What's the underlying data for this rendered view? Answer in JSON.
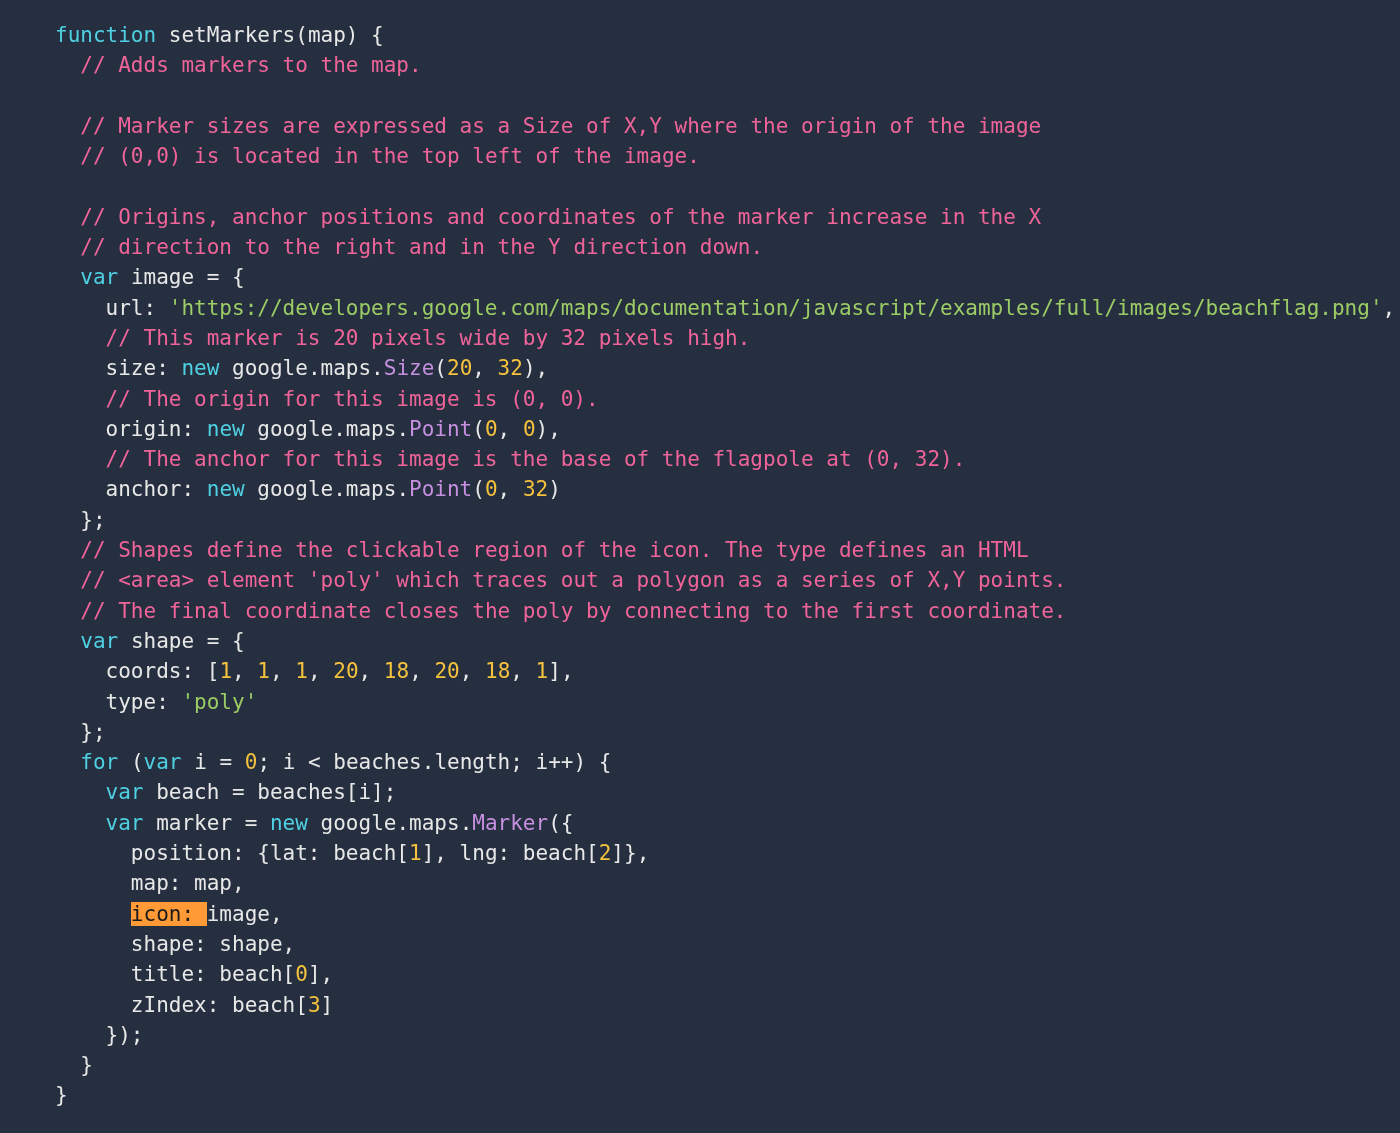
{
  "code_lines": [
    {
      "kind": "code",
      "tokens": [
        {
          "kind": "keyword",
          "text": "function"
        },
        {
          "kind": "plain",
          "text": " setMarkers(map) {"
        }
      ]
    },
    {
      "kind": "code",
      "tokens": [
        {
          "kind": "comment",
          "text": "  // Adds markers to the map."
        }
      ]
    },
    {
      "kind": "blank"
    },
    {
      "kind": "code",
      "tokens": [
        {
          "kind": "comment",
          "text": "  // Marker sizes are expressed as a Size of X,Y where the origin of the image"
        }
      ]
    },
    {
      "kind": "code",
      "tokens": [
        {
          "kind": "comment",
          "text": "  // (0,0) is located in the top left of the image."
        }
      ]
    },
    {
      "kind": "blank"
    },
    {
      "kind": "code",
      "tokens": [
        {
          "kind": "comment",
          "text": "  // Origins, anchor positions and coordinates of the marker increase in the X"
        }
      ]
    },
    {
      "kind": "code",
      "tokens": [
        {
          "kind": "comment",
          "text": "  // direction to the right and in the Y direction down."
        }
      ]
    },
    {
      "kind": "code",
      "tokens": [
        {
          "kind": "keyword",
          "text": "  var"
        },
        {
          "kind": "plain",
          "text": " image = {"
        }
      ]
    },
    {
      "kind": "code",
      "tokens": [
        {
          "kind": "plain",
          "text": "    url: "
        },
        {
          "kind": "string",
          "text": "'https://developers.google.com/maps/documentation/javascript/examples/full/images/beachflag.png'"
        },
        {
          "kind": "plain",
          "text": ","
        }
      ]
    },
    {
      "kind": "code",
      "tokens": [
        {
          "kind": "comment",
          "text": "    // This marker is 20 pixels wide by 32 pixels high."
        }
      ]
    },
    {
      "kind": "code",
      "tokens": [
        {
          "kind": "plain",
          "text": "    size: "
        },
        {
          "kind": "keyword",
          "text": "new"
        },
        {
          "kind": "plain",
          "text": " google.maps."
        },
        {
          "kind": "method",
          "text": "Size"
        },
        {
          "kind": "plain",
          "text": "("
        },
        {
          "kind": "number",
          "text": "20"
        },
        {
          "kind": "plain",
          "text": ", "
        },
        {
          "kind": "number",
          "text": "32"
        },
        {
          "kind": "plain",
          "text": "),"
        }
      ]
    },
    {
      "kind": "code",
      "tokens": [
        {
          "kind": "comment",
          "text": "    // The origin for this image is (0, 0)."
        }
      ]
    },
    {
      "kind": "code",
      "tokens": [
        {
          "kind": "plain",
          "text": "    origin: "
        },
        {
          "kind": "keyword",
          "text": "new"
        },
        {
          "kind": "plain",
          "text": " google.maps."
        },
        {
          "kind": "method",
          "text": "Point"
        },
        {
          "kind": "plain",
          "text": "("
        },
        {
          "kind": "number",
          "text": "0"
        },
        {
          "kind": "plain",
          "text": ", "
        },
        {
          "kind": "number",
          "text": "0"
        },
        {
          "kind": "plain",
          "text": "),"
        }
      ]
    },
    {
      "kind": "code",
      "tokens": [
        {
          "kind": "comment",
          "text": "    // The anchor for this image is the base of the flagpole at (0, 32)."
        }
      ]
    },
    {
      "kind": "code",
      "tokens": [
        {
          "kind": "plain",
          "text": "    anchor: "
        },
        {
          "kind": "keyword",
          "text": "new"
        },
        {
          "kind": "plain",
          "text": " google.maps."
        },
        {
          "kind": "method",
          "text": "Point"
        },
        {
          "kind": "plain",
          "text": "("
        },
        {
          "kind": "number",
          "text": "0"
        },
        {
          "kind": "plain",
          "text": ", "
        },
        {
          "kind": "number",
          "text": "32"
        },
        {
          "kind": "plain",
          "text": ")"
        }
      ]
    },
    {
      "kind": "code",
      "tokens": [
        {
          "kind": "plain",
          "text": "  };"
        }
      ]
    },
    {
      "kind": "code",
      "tokens": [
        {
          "kind": "comment",
          "text": "  // Shapes define the clickable region of the icon. The type defines an HTML"
        }
      ]
    },
    {
      "kind": "code",
      "tokens": [
        {
          "kind": "comment",
          "text": "  // <area> element 'poly' which traces out a polygon as a series of X,Y points."
        }
      ]
    },
    {
      "kind": "code",
      "tokens": [
        {
          "kind": "comment",
          "text": "  // The final coordinate closes the poly by connecting to the first coordinate."
        }
      ]
    },
    {
      "kind": "code",
      "tokens": [
        {
          "kind": "keyword",
          "text": "  var"
        },
        {
          "kind": "plain",
          "text": " shape = {"
        }
      ]
    },
    {
      "kind": "code",
      "tokens": [
        {
          "kind": "plain",
          "text": "    coords: ["
        },
        {
          "kind": "number",
          "text": "1"
        },
        {
          "kind": "plain",
          "text": ", "
        },
        {
          "kind": "number",
          "text": "1"
        },
        {
          "kind": "plain",
          "text": ", "
        },
        {
          "kind": "number",
          "text": "1"
        },
        {
          "kind": "plain",
          "text": ", "
        },
        {
          "kind": "number",
          "text": "20"
        },
        {
          "kind": "plain",
          "text": ", "
        },
        {
          "kind": "number",
          "text": "18"
        },
        {
          "kind": "plain",
          "text": ", "
        },
        {
          "kind": "number",
          "text": "20"
        },
        {
          "kind": "plain",
          "text": ", "
        },
        {
          "kind": "number",
          "text": "18"
        },
        {
          "kind": "plain",
          "text": ", "
        },
        {
          "kind": "number",
          "text": "1"
        },
        {
          "kind": "plain",
          "text": "],"
        }
      ]
    },
    {
      "kind": "code",
      "tokens": [
        {
          "kind": "plain",
          "text": "    type: "
        },
        {
          "kind": "string",
          "text": "'poly'"
        }
      ]
    },
    {
      "kind": "code",
      "tokens": [
        {
          "kind": "plain",
          "text": "  };"
        }
      ]
    },
    {
      "kind": "code",
      "tokens": [
        {
          "kind": "keyword",
          "text": "  for"
        },
        {
          "kind": "plain",
          "text": " ("
        },
        {
          "kind": "keyword",
          "text": "var"
        },
        {
          "kind": "plain",
          "text": " i = "
        },
        {
          "kind": "number",
          "text": "0"
        },
        {
          "kind": "plain",
          "text": "; i < beaches.length; i++) {"
        }
      ]
    },
    {
      "kind": "code",
      "tokens": [
        {
          "kind": "keyword",
          "text": "    var"
        },
        {
          "kind": "plain",
          "text": " beach = beaches[i];"
        }
      ]
    },
    {
      "kind": "code",
      "tokens": [
        {
          "kind": "keyword",
          "text": "    var"
        },
        {
          "kind": "plain",
          "text": " marker = "
        },
        {
          "kind": "keyword",
          "text": "new"
        },
        {
          "kind": "plain",
          "text": " google.maps."
        },
        {
          "kind": "method",
          "text": "Marker"
        },
        {
          "kind": "plain",
          "text": "({"
        }
      ]
    },
    {
      "kind": "code",
      "tokens": [
        {
          "kind": "plain",
          "text": "      position: {lat: beach["
        },
        {
          "kind": "number",
          "text": "1"
        },
        {
          "kind": "plain",
          "text": "], lng: beach["
        },
        {
          "kind": "number",
          "text": "2"
        },
        {
          "kind": "plain",
          "text": "]},"
        }
      ]
    },
    {
      "kind": "code",
      "tokens": [
        {
          "kind": "plain",
          "text": "      map: map,"
        }
      ]
    },
    {
      "kind": "code",
      "tokens": [
        {
          "kind": "highlight",
          "text": "      icon: "
        },
        {
          "kind": "plain",
          "text": "image,"
        }
      ]
    },
    {
      "kind": "code",
      "tokens": [
        {
          "kind": "plain",
          "text": "      shape: shape,"
        }
      ]
    },
    {
      "kind": "code",
      "tokens": [
        {
          "kind": "plain",
          "text": "      title: beach["
        },
        {
          "kind": "number",
          "text": "0"
        },
        {
          "kind": "plain",
          "text": "],"
        }
      ]
    },
    {
      "kind": "code",
      "tokens": [
        {
          "kind": "plain",
          "text": "      zIndex: beach["
        },
        {
          "kind": "number",
          "text": "3"
        },
        {
          "kind": "plain",
          "text": "]"
        }
      ]
    },
    {
      "kind": "code",
      "tokens": [
        {
          "kind": "plain",
          "text": "    });"
        }
      ]
    },
    {
      "kind": "code",
      "tokens": [
        {
          "kind": "plain",
          "text": "  }"
        }
      ]
    },
    {
      "kind": "code",
      "tokens": [
        {
          "kind": "plain",
          "text": "}"
        }
      ]
    }
  ]
}
